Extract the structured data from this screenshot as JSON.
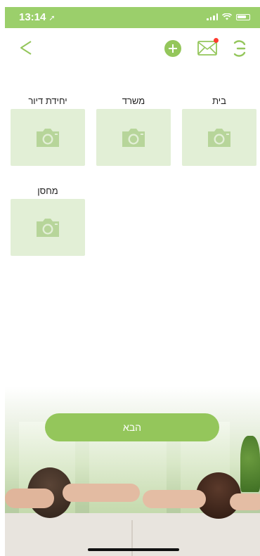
{
  "status_bar": {
    "time": "13:14",
    "location_glyph": "➚"
  },
  "header": {
    "icons": [
      "back-arrow-icon",
      "add-icon",
      "mail-icon",
      "menu-icon"
    ],
    "has_mail_notification": true
  },
  "tiles": [
    {
      "label": "בית",
      "icon": "camera-icon"
    },
    {
      "label": "משרד",
      "icon": "camera-icon"
    },
    {
      "label": "יחידת דיור",
      "icon": "camera-icon"
    },
    {
      "label": "מחסן",
      "icon": "camera-icon"
    }
  ],
  "next_button": {
    "label": "הבא"
  },
  "colors": {
    "accent": "#94c65b",
    "status_bar": "#9bcf6b",
    "tile_bg": "#e2efd6",
    "tile_icon": "#b7d59a"
  }
}
